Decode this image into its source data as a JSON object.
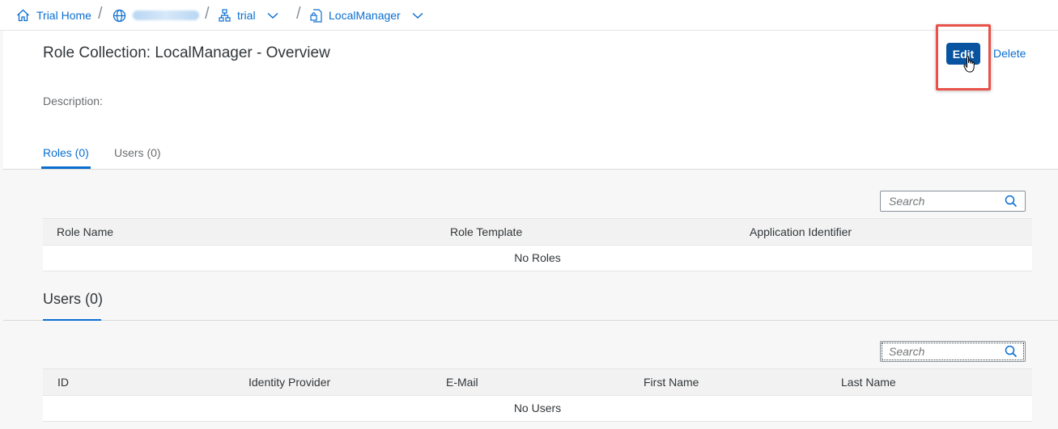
{
  "breadcrumb": {
    "home": "Trial Home",
    "subaccount": "trial",
    "current": "LocalManager"
  },
  "header": {
    "title": "Role Collection: LocalManager - Overview",
    "description_label": "Description:",
    "edit_label": "Edit",
    "delete_label": "Delete"
  },
  "tabs": [
    {
      "label": "Roles (0)"
    },
    {
      "label": "Users (0)"
    }
  ],
  "roles": {
    "search_placeholder": "Search",
    "columns": [
      "Role Name",
      "Role Template",
      "Application Identifier"
    ],
    "empty_text": "No Roles"
  },
  "users": {
    "heading": "Users (0)",
    "search_placeholder": "Search",
    "columns": [
      "ID",
      "Identity Provider",
      "E-Mail",
      "First Name",
      "Last Name"
    ],
    "empty_text": "No Users"
  },
  "colors": {
    "accent": "#0a6ed1",
    "button": "#0854a0",
    "highlight": "#e8524a"
  }
}
